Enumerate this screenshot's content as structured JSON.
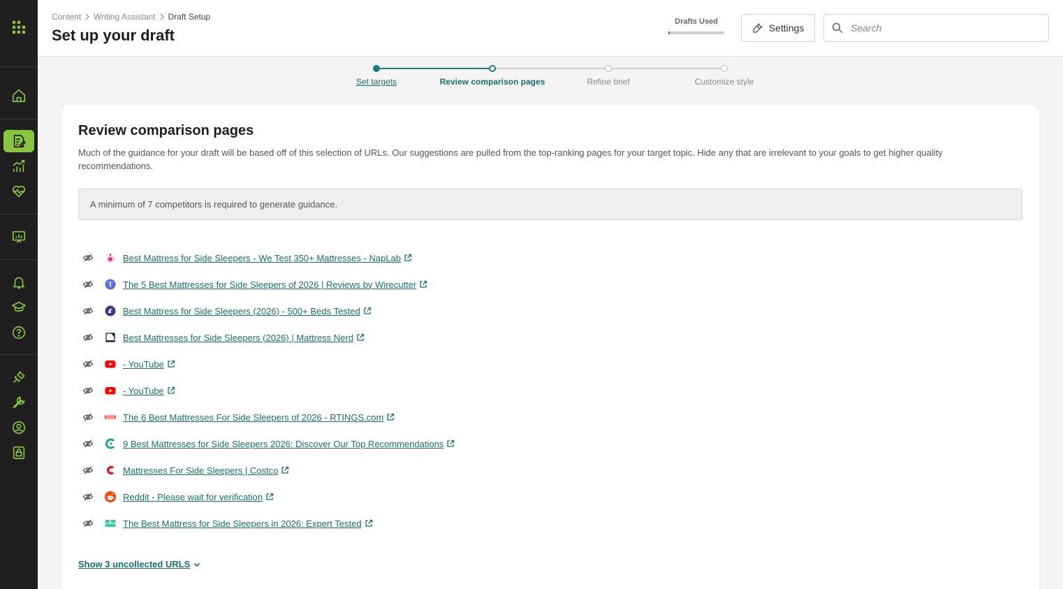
{
  "sidebar": {
    "items": [
      {
        "name": "home",
        "icon": "home-icon"
      },
      {
        "name": "content-writer",
        "icon": "document-edit-icon",
        "active": true
      },
      {
        "name": "analytics",
        "icon": "chart-growth-icon"
      },
      {
        "name": "health",
        "icon": "heart-pulse-icon"
      },
      {
        "name": "presentation",
        "icon": "presentation-chart-icon"
      },
      {
        "name": "notifications",
        "icon": "bell-icon"
      },
      {
        "name": "academy",
        "icon": "graduation-cap-icon"
      },
      {
        "name": "help",
        "icon": "help-circle-icon"
      },
      {
        "name": "integrations",
        "icon": "plug-icon"
      },
      {
        "name": "tools",
        "icon": "wrench-icon"
      },
      {
        "name": "account",
        "icon": "user-circle-icon"
      },
      {
        "name": "security",
        "icon": "lock-icon"
      }
    ],
    "accent": "#8bc540"
  },
  "header": {
    "breadcrumb": [
      "Content",
      "Writing Assistant",
      "Draft Setup"
    ],
    "title": "Set up your draft",
    "drafts_used_label": "Drafts Used",
    "drafts_used_fraction": 0.03,
    "settings_label": "Settings",
    "search_placeholder": "Search"
  },
  "stepper": {
    "steps": [
      {
        "label": "Set targets",
        "state": "done"
      },
      {
        "label": "Review comparison pages",
        "state": "current"
      },
      {
        "label": "Refine brief",
        "state": "todo"
      },
      {
        "label": "Customize style",
        "state": "todo"
      }
    ],
    "accent": "#1a7d74"
  },
  "card": {
    "title": "Review comparison pages",
    "description": "Much of the guidance for your draft will be based off of this selection of URLs. Our suggestions are pulled from the top-ranking pages for your target topic. Hide any that are irrelevant to your goals to get higher quality recommendations.",
    "notice": "A minimum of 7 competitors is required to generate guidance.",
    "urls": [
      {
        "title": "Best Mattress for Side Sleepers - We Test 350+ Mattresses - NapLab",
        "favicon": "naplab-icon"
      },
      {
        "title": "The 5 Best Mattresses for Side Sleepers of 2026 | Reviews by Wirecutter",
        "favicon": "nytimes-icon"
      },
      {
        "title": "Best Mattress for Side Sleepers (2026) - 500+ Beds Tested",
        "favicon": "sleepfoundation-icon"
      },
      {
        "title": "Best Mattresses for Side Sleepers (2026) | Mattress Nerd",
        "favicon": "mattressnerd-icon"
      },
      {
        "title": "- YouTube",
        "favicon": "youtube-icon"
      },
      {
        "title": "- YouTube",
        "favicon": "youtube-icon"
      },
      {
        "title": "The 6 Best Mattresses For Side Sleepers of 2026 - RTINGS.com",
        "favicon": "rtings-icon"
      },
      {
        "title": "9 Best Mattresses for Side Sleepers 2026: Discover Our Top Recommendations",
        "favicon": "sleepopolis-icon"
      },
      {
        "title": "Mattresses For Side Sleepers | Costco",
        "favicon": "costco-icon"
      },
      {
        "title": "Reddit - Please wait for verification",
        "favicon": "reddit-icon"
      },
      {
        "title": "The Best Mattress for Side Sleepers in 2026: Expert Tested",
        "favicon": "mattressclarity-icon"
      }
    ],
    "show_more_label": "Show 3 uncollected URLS"
  }
}
